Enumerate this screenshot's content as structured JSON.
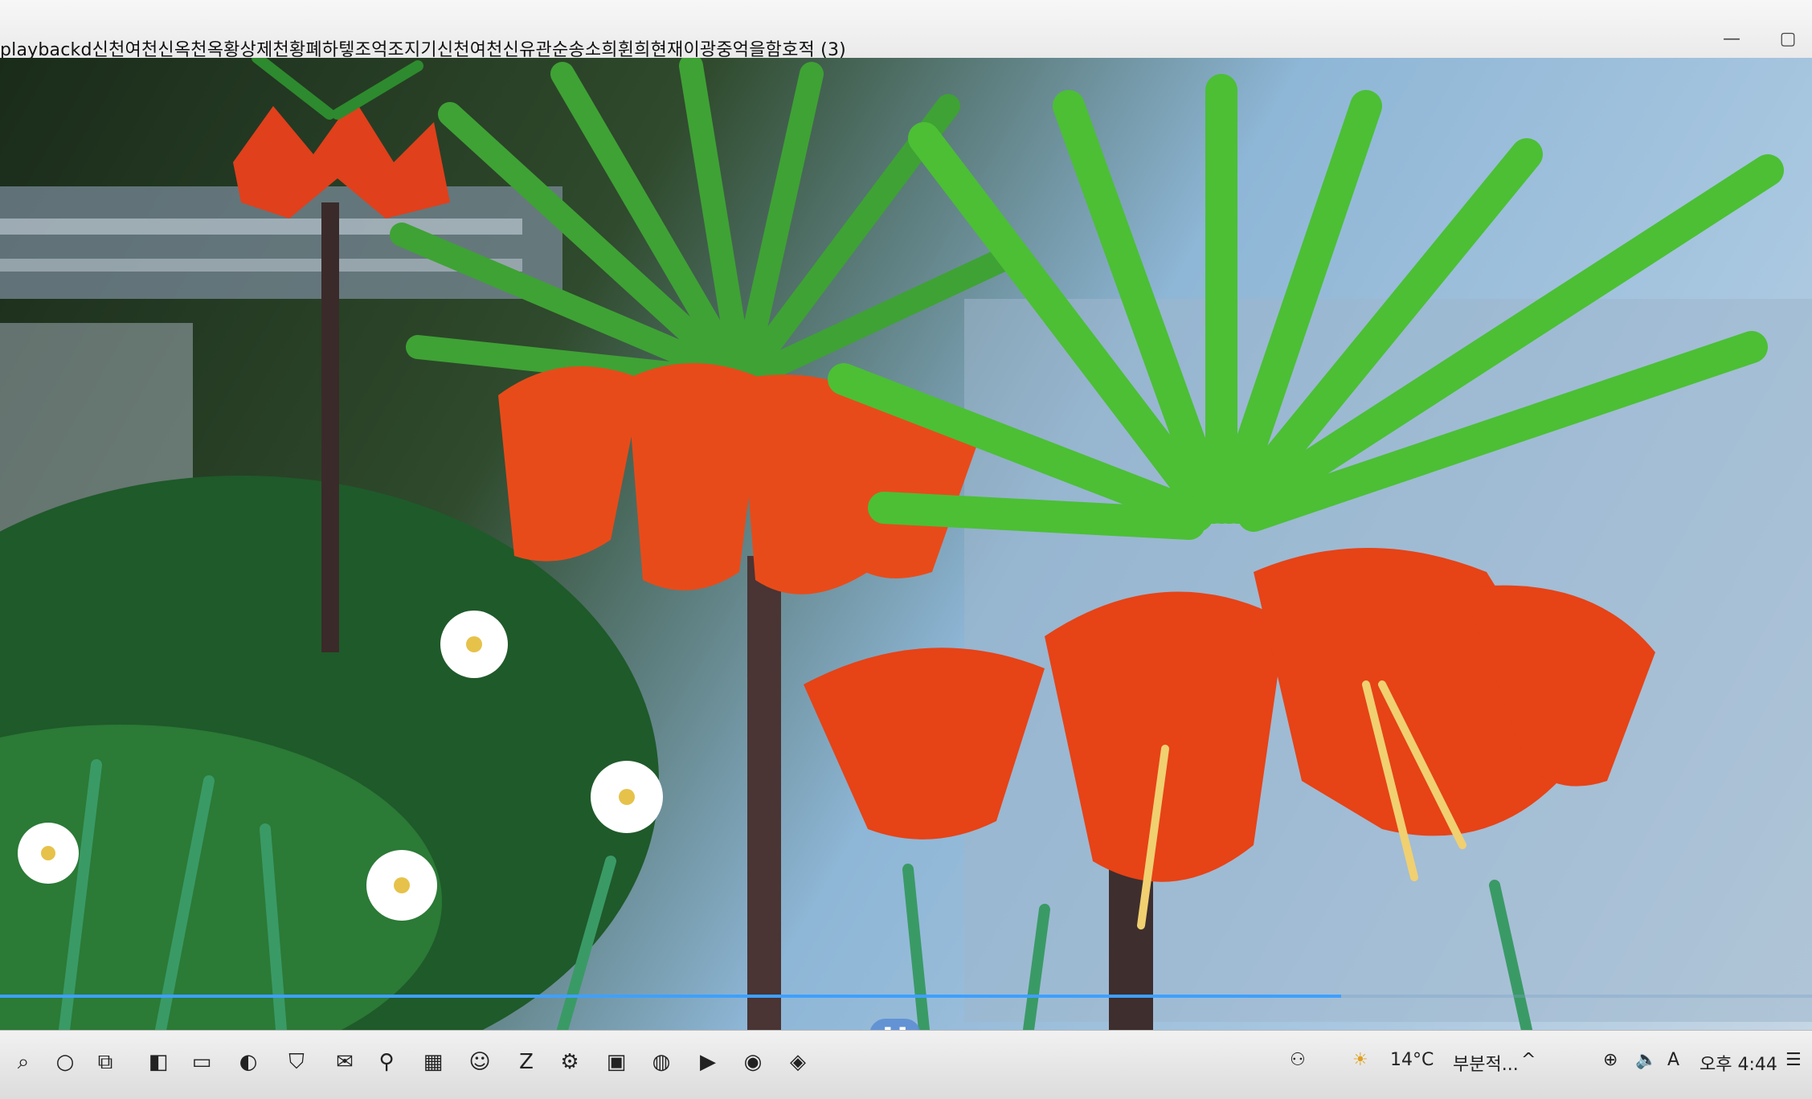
{
  "window": {
    "title": "playbackd신천여천신옥천옥황상제천황폐하텧조억조지기신천여천신유관순송소희휜희현재이광중억을함호적 (3)",
    "minimize_glyph": "—",
    "maximize_glyph": "▢"
  },
  "player": {
    "progress": 0.74,
    "pause_glyph": "❚❚"
  },
  "taskbar": {
    "icons": [
      {
        "name": "search-icon",
        "glyph": "⌕"
      },
      {
        "name": "cortana-icon",
        "glyph": "○"
      },
      {
        "name": "task-view-icon",
        "glyph": "⧉"
      },
      {
        "name": "office-icon",
        "glyph": "◧"
      },
      {
        "name": "file-explorer-icon",
        "glyph": "▭"
      },
      {
        "name": "edge-icon",
        "glyph": "◐"
      },
      {
        "name": "security-icon",
        "glyph": "⛉"
      },
      {
        "name": "mail-icon",
        "glyph": "✉"
      },
      {
        "name": "magnifier-icon",
        "glyph": "⚲"
      },
      {
        "name": "app-grid-icon",
        "glyph": "▦"
      },
      {
        "name": "messenger-icon",
        "glyph": "☺"
      },
      {
        "name": "filezilla-icon",
        "glyph": "Z"
      },
      {
        "name": "settings-icon",
        "glyph": "⚙"
      },
      {
        "name": "photos-icon",
        "glyph": "▣"
      },
      {
        "name": "browser-icon",
        "glyph": "◍"
      },
      {
        "name": "media-player-icon",
        "glyph": "▶"
      },
      {
        "name": "app-red-icon",
        "glyph": "◉"
      },
      {
        "name": "app-shield-icon",
        "glyph": "◈"
      }
    ],
    "tray": {
      "people_glyph": "⚇",
      "weather_glyph": "☀",
      "temperature": "14°C",
      "weather_text": "부분적...",
      "chevron_glyph": "^",
      "network_glyph": "⊕",
      "volume_glyph": "🔈",
      "ime": "A",
      "time": "오후 4:44",
      "notification_glyph": "☰"
    }
  }
}
